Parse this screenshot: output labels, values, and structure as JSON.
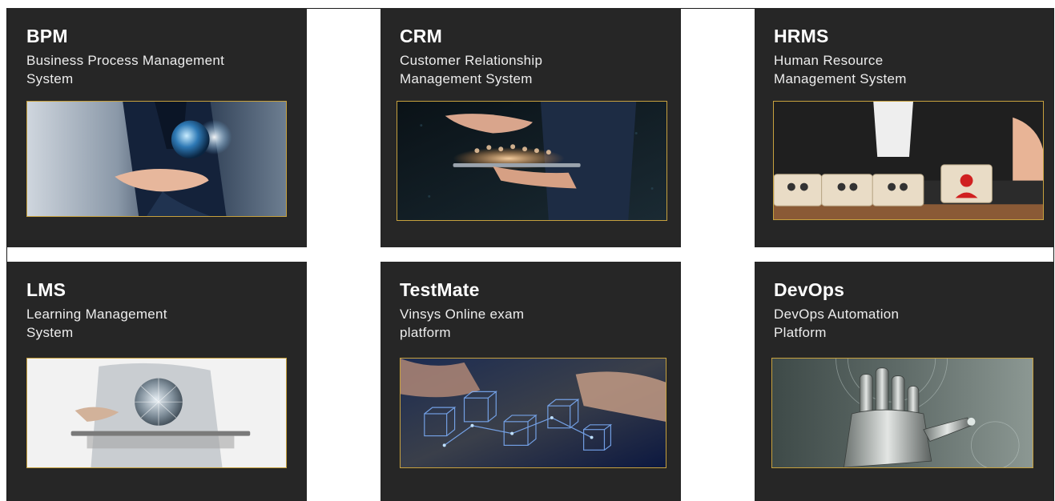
{
  "cards": [
    {
      "title": "BPM",
      "subtitle_line1": "Business Process Management",
      "subtitle_line2": "System",
      "image_icon": "globe-in-hand-icon"
    },
    {
      "title": "CRM",
      "subtitle_line1": "Customer Relationship",
      "subtitle_line2": "Management System",
      "image_icon": "network-tablet-icon"
    },
    {
      "title": "HRMS",
      "subtitle_line1": "Human Resource",
      "subtitle_line2": "Management System",
      "image_icon": "puzzle-people-icon"
    },
    {
      "title": "LMS",
      "subtitle_line1": "Learning Management",
      "subtitle_line2": "System",
      "image_icon": "tablet-globe-icon"
    },
    {
      "title": "TestMate",
      "subtitle_line1": "Vinsys Online exam",
      "subtitle_line2": "platform",
      "image_icon": "cubes-hands-icon"
    },
    {
      "title": "DevOps",
      "subtitle_line1": "DevOps Automation",
      "subtitle_line2": "Platform",
      "image_icon": "robot-hand-icon"
    }
  ],
  "colors": {
    "card_bg": "#262626",
    "thumb_border": "#c7a13e",
    "text": "#f2f2f2"
  }
}
